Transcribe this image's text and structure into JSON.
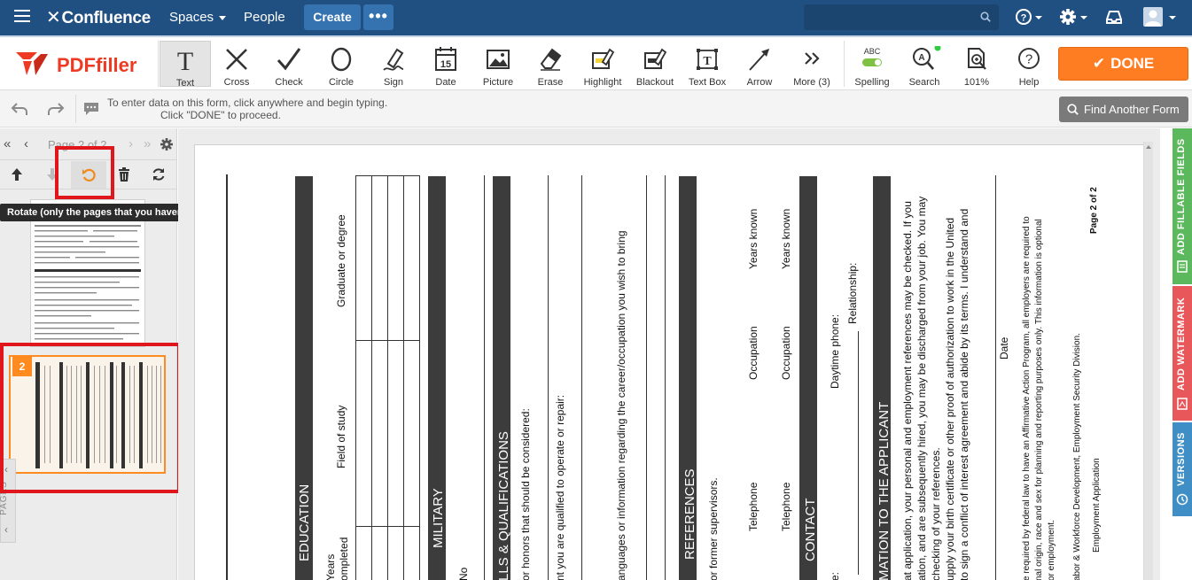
{
  "confluence": {
    "logo": "Confluence",
    "spaces": "Spaces",
    "people": "People",
    "create": "Create",
    "more": "•••"
  },
  "pdffiller": {
    "logo": "PDFfiller",
    "tools": [
      {
        "id": "text",
        "label": "Text",
        "icon": "text-icon"
      },
      {
        "id": "cross",
        "label": "Cross",
        "icon": "cross-icon"
      },
      {
        "id": "check",
        "label": "Check",
        "icon": "check-icon"
      },
      {
        "id": "circle",
        "label": "Circle",
        "icon": "circle-icon"
      },
      {
        "id": "sign",
        "label": "Sign",
        "icon": "pen-icon"
      },
      {
        "id": "date",
        "label": "Date",
        "icon": "calendar-icon"
      },
      {
        "id": "picture",
        "label": "Picture",
        "icon": "picture-icon"
      },
      {
        "id": "erase",
        "label": "Erase",
        "icon": "eraser-icon"
      },
      {
        "id": "highlight",
        "label": "Highlight",
        "icon": "highlight-icon"
      },
      {
        "id": "blackout",
        "label": "Blackout",
        "icon": "blackout-icon"
      },
      {
        "id": "textbox",
        "label": "Text Box",
        "icon": "textbox-icon"
      },
      {
        "id": "arrow",
        "label": "Arrow",
        "icon": "arrow-icon"
      },
      {
        "id": "more",
        "label": "More (3)",
        "icon": "chevrons-right-icon"
      }
    ],
    "spelling_label": "Spelling",
    "spelling_abc": "ABC",
    "search_label": "Search",
    "zoom_label": "101%",
    "help_label": "Help",
    "date_day": "15",
    "done_label": "DONE"
  },
  "info": {
    "line1": "To enter data on this form, click anywhere and begin typing.",
    "line2": "Click \"DONE\" to proceed.",
    "find_form": "Find Another Form"
  },
  "pages_panel": {
    "page_label": "Page 2 of 2",
    "tooltip": "Rotate (only the pages that you haven't added content to)",
    "thumb2_badge": "2",
    "pages_tab": "PAGES"
  },
  "document": {
    "sections": {
      "education": "EDUCATION",
      "military": "MILITARY",
      "skills": "LLS & QUALIFICATIONS",
      "references": "REFERENCES",
      "contact": "CONTACT",
      "applicant": "MATION TO THE APPLICANT"
    },
    "edu_years": "Years",
    "edu_completed": "ompleted",
    "edu_field": "Field of study",
    "edu_grad": "Graduate or degree",
    "mil_no": "No",
    "skill_1": "or honors that should be considered:",
    "skill_2": "nt you are qualified to operate or repair:",
    "skill_3": "anguages or information regarding the career/occupation you wish to bring",
    "ref_former": "or former supervisors.",
    "ref_tel_1": "Telephone",
    "ref_occ_1": "Occupation",
    "ref_yrs_1": "Years known",
    "ref_tel_2": "Telephone",
    "ref_occ_2": "Occupation",
    "ref_yrs_2": "Years known",
    "contact_daytime": "Daytime phone:",
    "contact_relationship": "Relationship:",
    "contact_e": "e:",
    "app_1": "at application, your personal and employment references may be checked. If you",
    "app_2": "ation, and are subsequently hired, you may be discharged from your job. You may",
    "app_3": "checking of your references.",
    "app_4": "upply your birth certificate or other proof of authorization to work in the United",
    "app_5": "to sign a conflict of interest agreement and abide by its terms. I understand and",
    "app_date": "Date",
    "foot_1": "e required by federal law to have an Affirmative Action Program, all employers are required to",
    "foot_2": "nal origin, race and sex for planning and reporting purposes only. This information is optional",
    "foot_3": "or employment.",
    "foot_4": "abor & Workforce Development, Employment Security Division.",
    "foot_5": "Employment Application",
    "page_of": "Page 2 of 2"
  },
  "right_tabs": {
    "fillable": "ADD FILLABLE FIELDS",
    "watermark": "ADD WATERMARK",
    "versions": "VERSIONS"
  },
  "colors": {
    "confluence_blue": "#205081",
    "done_orange": "#ff7d22",
    "highlight_red": "#e0161c",
    "tab_green": "#5cb85c",
    "tab_red": "#e8575a",
    "tab_blue": "#3f8fc6"
  }
}
